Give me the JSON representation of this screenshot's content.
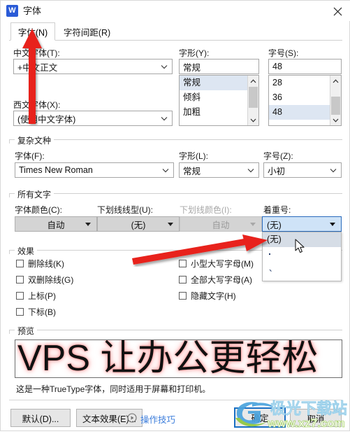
{
  "window": {
    "app_icon": "word-w-icon",
    "title": "字体",
    "close_icon": "close-icon"
  },
  "tabs": [
    {
      "label": "字体(N)",
      "active": true
    },
    {
      "label": "字符间距(R)",
      "active": false
    }
  ],
  "chinese_font": {
    "label": "中文字体(T):",
    "value": "+中文正文"
  },
  "latin_font": {
    "label": "西文字体(X):",
    "value": "(使用中文字体)"
  },
  "font_style": {
    "label": "字形(Y):",
    "value": "常规",
    "options": [
      "常规",
      "倾斜",
      "加粗"
    ],
    "selected_index": 0
  },
  "font_size": {
    "label": "字号(S):",
    "value": "48",
    "options": [
      "28",
      "36",
      "48"
    ],
    "selected_index": 2
  },
  "complex_script": {
    "group_title": "复杂文种",
    "font": {
      "label": "字体(F):",
      "value": "Times New Roman"
    },
    "style": {
      "label": "字形(L):",
      "value": "常规"
    },
    "size": {
      "label": "字号(Z):",
      "value": "小初"
    }
  },
  "all_text": {
    "group_title": "所有文字",
    "font_color": {
      "label": "字体颜色(C):",
      "value": "自动",
      "disabled": false
    },
    "underline_style": {
      "label": "下划线线型(U):",
      "value": "(无)",
      "disabled": false
    },
    "underline_color": {
      "label": "下划线颜色(I):",
      "value": "自动",
      "disabled": true
    },
    "emphasis_mark": {
      "label": "着重号:",
      "value": "(无)",
      "open": true,
      "options": [
        "(无)",
        "·",
        "、"
      ],
      "highlighted_index": 0
    }
  },
  "effects": {
    "group_title": "效果",
    "left_column": [
      {
        "label": "删除线(K)",
        "checked": false
      },
      {
        "label": "双删除线(G)",
        "checked": false
      },
      {
        "label": "上标(P)",
        "checked": false
      },
      {
        "label": "下标(B)",
        "checked": false
      }
    ],
    "right_column": [
      {
        "label": "小型大写字母(M)",
        "checked": false
      },
      {
        "label": "全部大写字母(A)",
        "checked": false
      },
      {
        "label": "隐藏文字(H)",
        "checked": false
      }
    ]
  },
  "preview": {
    "group_title": "预览",
    "sample_text": "VPS 让办公更轻松",
    "note": "这是一种TrueType字体，同时适用于屏幕和打印机。"
  },
  "footer": {
    "default_button": "默认(D)...",
    "text_effects_button": "文本效果(E)...",
    "tips_link": "操作技巧",
    "tips_icon": "play-circle-icon",
    "ok_button": "确定",
    "cancel_button": "取消"
  },
  "watermark": {
    "title": "极光下载站",
    "url": "www.xz7.com"
  },
  "colors": {
    "accent_blue": "#2a5bd7",
    "focus_blue": "#1a6fc4",
    "link_blue": "#3c7ddb",
    "selection": "#dde6f2",
    "annotation_red": "#e8201a"
  }
}
